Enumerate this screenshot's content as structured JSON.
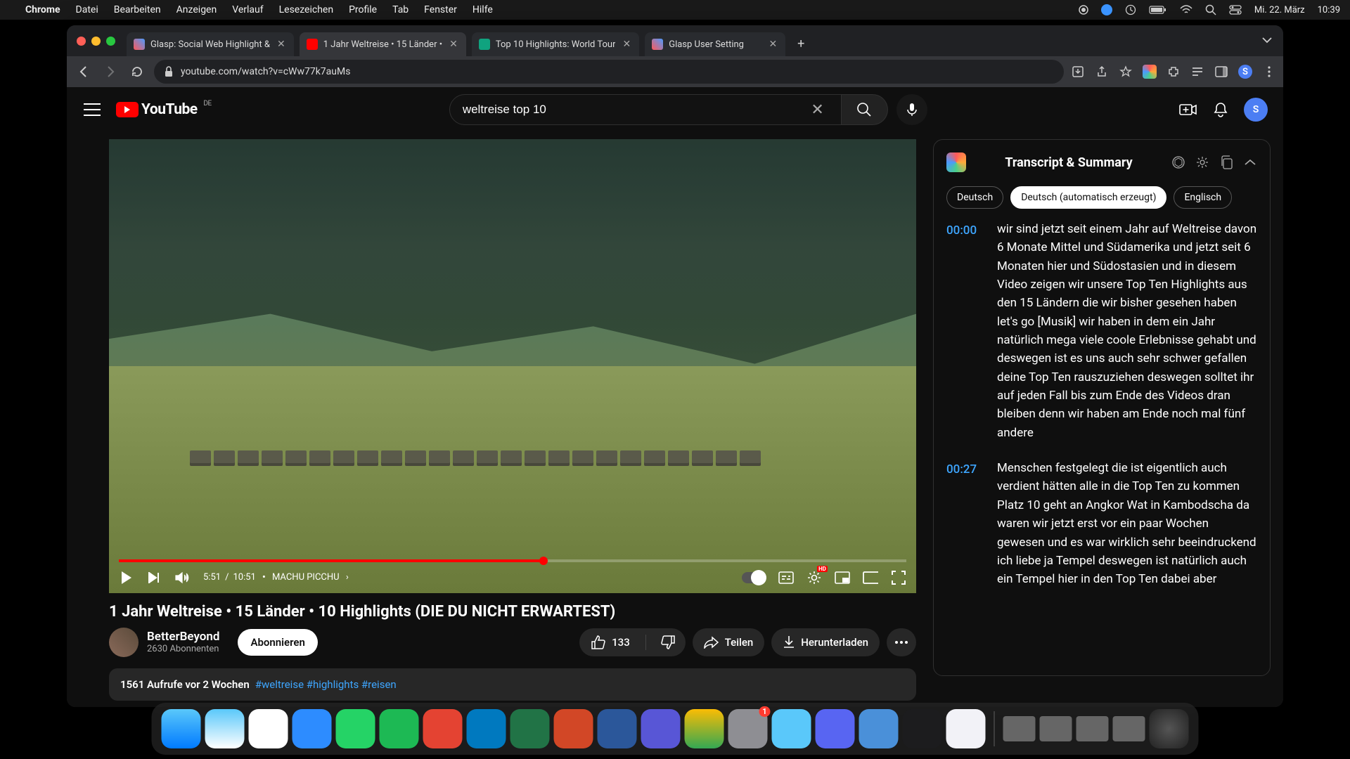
{
  "menubar": {
    "app": "Chrome",
    "items": [
      "Datei",
      "Bearbeiten",
      "Anzeigen",
      "Verlauf",
      "Lesezeichen",
      "Profile",
      "Tab",
      "Fenster",
      "Hilfe"
    ],
    "date": "Mi. 22. März",
    "time": "10:39"
  },
  "tabs": [
    {
      "title": "Glasp: Social Web Highlight &",
      "active": false
    },
    {
      "title": "1 Jahr Weltreise • 15 Länder •",
      "active": true
    },
    {
      "title": "Top 10 Highlights: World Tour",
      "active": false
    },
    {
      "title": "Glasp User Setting",
      "active": false
    }
  ],
  "address": {
    "url": "youtube.com/watch?v=cWw77k7auMs"
  },
  "youtube": {
    "country_code": "DE",
    "logo_text": "YouTube",
    "search_query": "weltreise top 10",
    "profile_letter": "S"
  },
  "player": {
    "current_time": "5:51",
    "duration": "10:51",
    "chapter": "MACHU PICCHU",
    "hd_badge": "HD"
  },
  "video": {
    "title": "1 Jahr Weltreise • 15 Länder • 10 Highlights (DIE DU NICHT ERWARTEST)",
    "channel_name": "BetterBeyond",
    "subscriber_count": "2630 Abonnenten",
    "subscribe_label": "Abonnieren",
    "like_count": "133",
    "share_label": "Teilen",
    "download_label": "Herunterladen",
    "views_age": "1561 Aufrufe  vor 2 Wochen",
    "hashtags": "#weltreise #highlights #reisen"
  },
  "transcript_panel": {
    "title": "Transcript & Summary",
    "languages": [
      "Deutsch",
      "Deutsch (automatisch erzeugt)",
      "Englisch"
    ],
    "active_language_index": 1,
    "entries": [
      {
        "time": "00:00",
        "text": "wir sind jetzt seit einem Jahr auf Weltreise  davon 6 Monate Mittel und Südamerika und jetzt   seit 6 Monaten hier und Südostasien und  in diesem Video zeigen wir unsere Top Ten   Highlights aus den 15 Ländern die wir  bisher gesehen haben let's go [Musik]   wir haben in dem ein Jahr natürlich mega viele  coole Erlebnisse gehabt und deswegen ist es uns auch sehr schwer gefallen deine Top Ten  rauszuziehen deswegen solltet ihr auf jeden   Fall bis zum Ende des Videos dran bleiben  denn wir haben am Ende noch mal fünf andere"
      },
      {
        "time": "00:27",
        "text": "Menschen festgelegt die ist eigentlich auch  verdient hätten alle in die Top Ten zu kommen Platz 10 geht an Angkor Wat in Kambodscha  da waren wir jetzt erst vor ein paar Wochen   gewesen und es war wirklich sehr beeindruckend  ich liebe ja Tempel deswegen ist natürlich auch ein Tempel hier in den Top Ten dabei aber"
      }
    ]
  },
  "dock": {
    "apps": [
      "finder",
      "safari",
      "chrome",
      "zoom",
      "whatsapp",
      "spotify",
      "todoist",
      "trello",
      "excel",
      "powerpoint",
      "word",
      "imovie",
      "gdrive",
      "settings",
      "messages",
      "discord",
      "quicktime",
      "voice",
      "preview"
    ],
    "settings_badge": "1"
  }
}
